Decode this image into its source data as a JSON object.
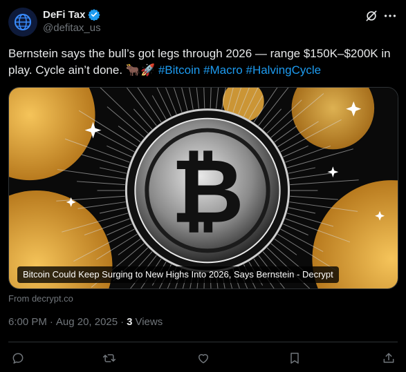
{
  "author": {
    "display_name": "DeFi Tax",
    "handle": "@defitax_us",
    "verified": true
  },
  "tweet": {
    "text_plain": "Bernstein says the bull’s got legs through 2026 — range $150K–$200K in play. Cycle ain’t done. 🐂🚀 ",
    "hashtags": [
      "#Bitcoin",
      "#Macro",
      "#HalvingCycle"
    ]
  },
  "card": {
    "caption": "Bitcoin Could Keep Surging to New Highs Into 2026, Says Bernstein - Decrypt",
    "source": "From decrypt.co"
  },
  "meta": {
    "time": "6:00 PM",
    "date": "Aug 20, 2025",
    "views_count": "3",
    "views_label": "Views"
  },
  "icons": {
    "verified": "verified-badge-icon",
    "grok": "grok-icon",
    "more": "more-icon",
    "reply": "reply-icon",
    "retweet": "retweet-icon",
    "like": "like-icon",
    "bookmark": "bookmark-icon",
    "share": "share-icon"
  },
  "colors": {
    "background": "#000000",
    "text": "#e7e9ea",
    "muted": "#71767b",
    "accent": "#1d9bf0",
    "gold": "#e8a93a"
  }
}
